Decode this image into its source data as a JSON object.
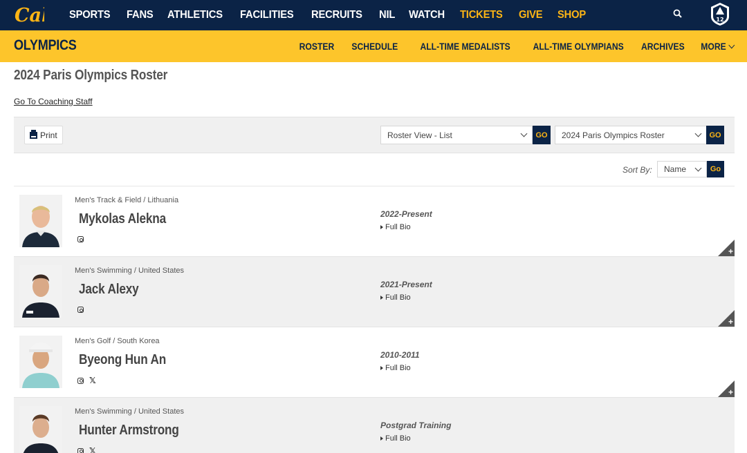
{
  "brand": {
    "logo_text": "Cal",
    "conference_logo_text": "12"
  },
  "topnav": {
    "items": [
      {
        "label": "SPORTS",
        "gold": false
      },
      {
        "label": "FANS",
        "gold": false
      },
      {
        "label": "ATHLETICS",
        "gold": false
      },
      {
        "label": "FACILITIES",
        "gold": false
      },
      {
        "label": "RECRUITS",
        "gold": false
      },
      {
        "label": "NIL",
        "gold": false
      },
      {
        "label": "WATCH",
        "gold": false
      },
      {
        "label": "TICKETS",
        "gold": true
      },
      {
        "label": "GIVE",
        "gold": true
      },
      {
        "label": "SHOP",
        "gold": true
      }
    ]
  },
  "subnav": {
    "title": "OLYMPICS",
    "items": [
      "ROSTER",
      "SCHEDULE",
      "ALL-TIME MEDALISTS",
      "ALL-TIME OLYMPIANS",
      "ARCHIVES",
      "MORE"
    ]
  },
  "page": {
    "title": "2024 Paris Olympics Roster",
    "coaching_link": "Go To Coaching Staff"
  },
  "toolbar": {
    "print_label": "Print",
    "view_select": "Roster View - List",
    "roster_select": "2024 Paris Olympics Roster",
    "go_label": "GO"
  },
  "sort": {
    "label": "Sort By:",
    "value": "Name",
    "go_label": "Go"
  },
  "roster": [
    {
      "sport": "Men's Track & Field / Lithuania",
      "name": "Mykolas Alekna",
      "years": "2022-Present",
      "bio": "Full Bio",
      "socials": [
        "instagram"
      ]
    },
    {
      "sport": "Men's Swimming / United States",
      "name": "Jack Alexy",
      "years": "2021-Present",
      "bio": "Full Bio",
      "socials": [
        "instagram"
      ]
    },
    {
      "sport": "Men's Golf / South Korea",
      "name": "Byeong Hun An",
      "years": "2010-2011",
      "bio": "Full Bio",
      "socials": [
        "instagram",
        "x"
      ]
    },
    {
      "sport": "Men's Swimming / United States",
      "name": "Hunter Armstrong",
      "years": "Postgrad Training",
      "bio": "Full Bio",
      "socials": [
        "instagram",
        "x"
      ]
    }
  ],
  "colors": {
    "navy": "#0b2346",
    "gold": "#fdb515",
    "subnav_gold": "#fdc52b"
  }
}
